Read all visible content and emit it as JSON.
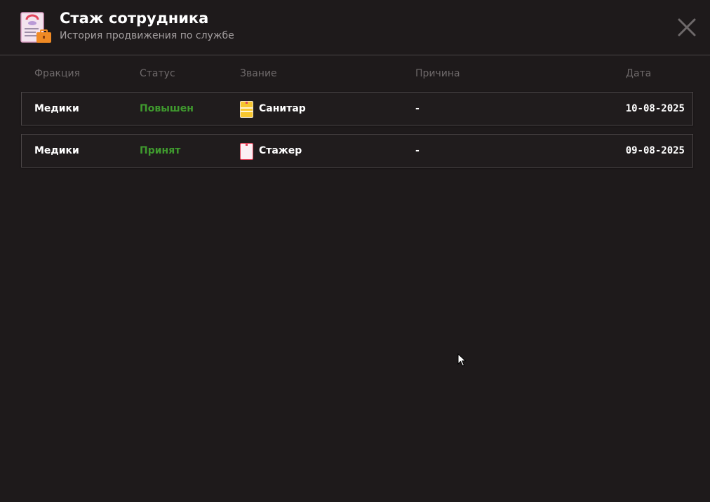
{
  "header": {
    "title": "Стаж сотрудника",
    "subtitle": "История продвижения по службе",
    "app_icon": "document-briefcase-icon",
    "close_icon": "close-icon"
  },
  "table": {
    "columns": [
      "Фракция",
      "Статус",
      "Звание",
      "Причина",
      "Дата"
    ],
    "rows": [
      {
        "faction": "Медики",
        "status": "Повышен",
        "rank": "Санитар",
        "rank_icon": "rank-badge-yellow-icon",
        "reason": "-",
        "date": "10-08-2025"
      },
      {
        "faction": "Медики",
        "status": "Принят",
        "rank": "Стажер",
        "rank_icon": "rank-badge-white-icon",
        "reason": "-",
        "date": "09-08-2025"
      }
    ]
  },
  "colors": {
    "background": "#1e1a1b",
    "status_green": "#3f9a2e",
    "muted_text": "#6e696a",
    "border": "#4b4647"
  }
}
